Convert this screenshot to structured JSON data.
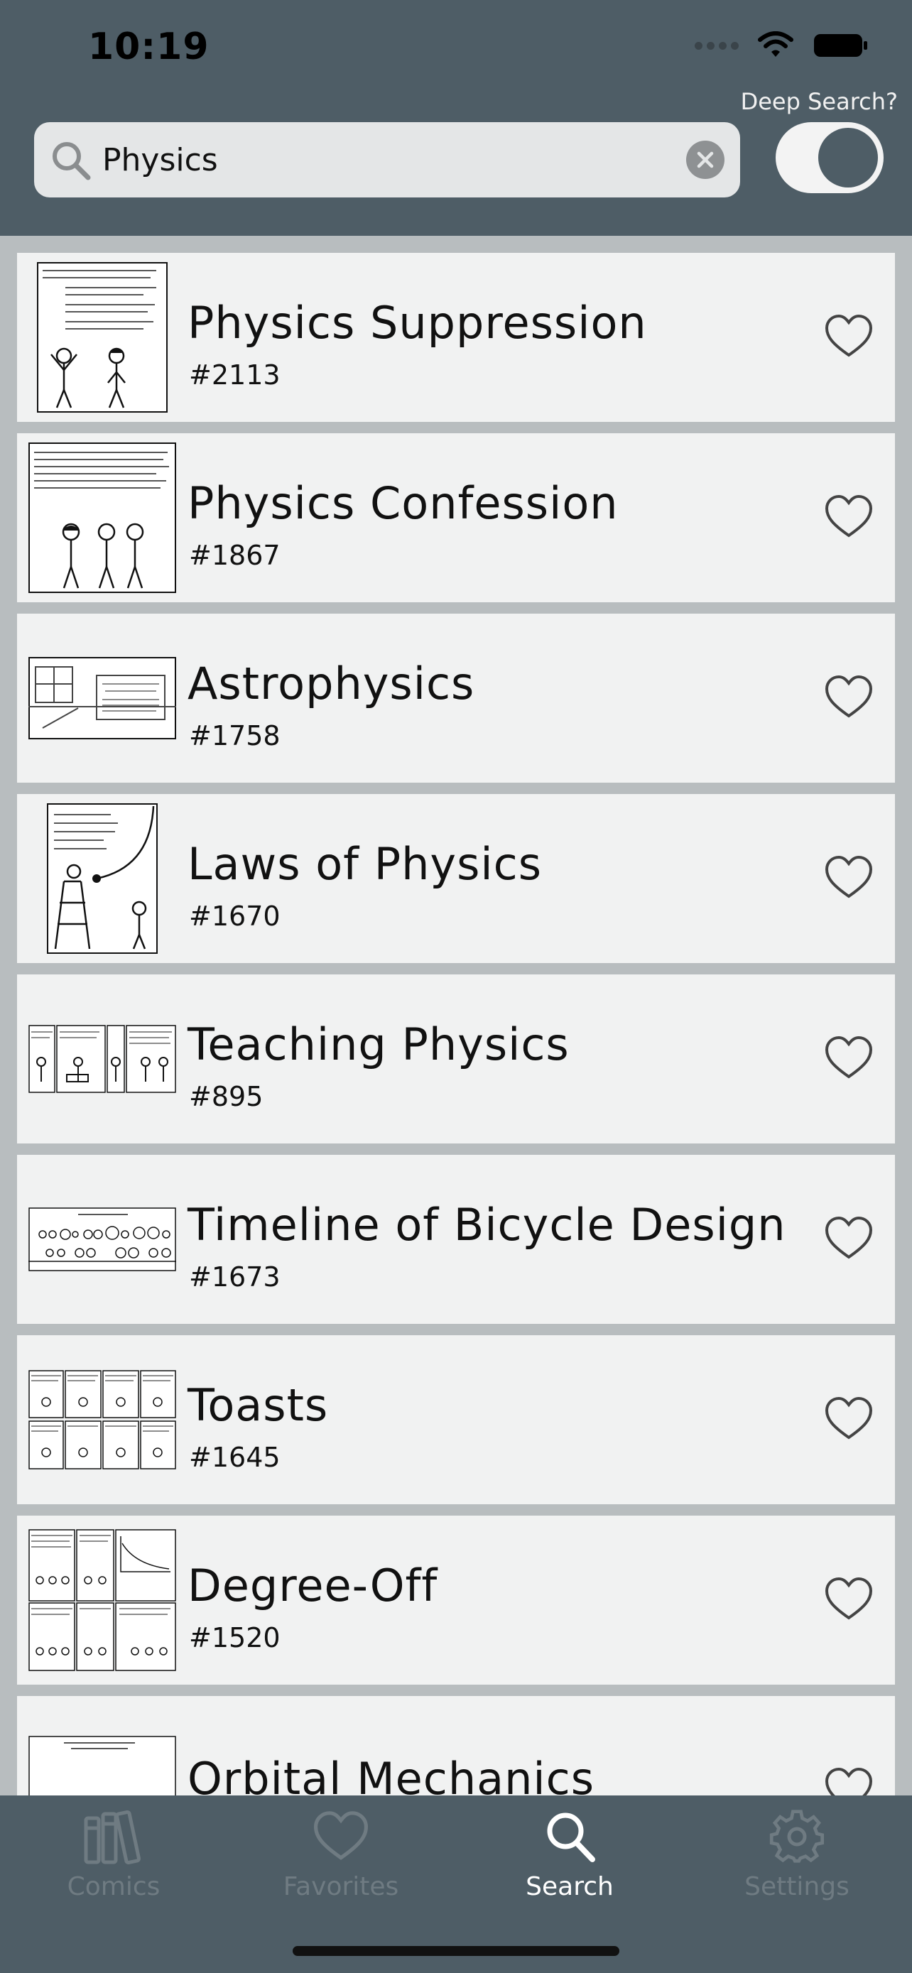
{
  "status_bar": {
    "time": "10:19"
  },
  "header": {
    "deep_search_label": "Deep Search?",
    "deep_search_on": true,
    "search": {
      "value": "Physics",
      "placeholder": "Search"
    }
  },
  "results": [
    {
      "title": "Physics Suppression",
      "number": "#2113",
      "favorite": false
    },
    {
      "title": "Physics Confession",
      "number": "#1867",
      "favorite": false
    },
    {
      "title": "Astrophysics",
      "number": "#1758",
      "favorite": false
    },
    {
      "title": "Laws of Physics",
      "number": "#1670",
      "favorite": false
    },
    {
      "title": "Teaching Physics",
      "number": "#895",
      "favorite": false
    },
    {
      "title": "Timeline of Bicycle Design",
      "number": "#1673",
      "favorite": false
    },
    {
      "title": "Toasts",
      "number": "#1645",
      "favorite": false
    },
    {
      "title": "Degree-Off",
      "number": "#1520",
      "favorite": false
    },
    {
      "title": "Orbital Mechanics",
      "number": "",
      "favorite": false
    }
  ],
  "tabs": [
    {
      "label": "Comics",
      "icon": "books-icon",
      "active": false
    },
    {
      "label": "Favorites",
      "icon": "heart-icon",
      "active": false
    },
    {
      "label": "Search",
      "icon": "search-icon",
      "active": true
    },
    {
      "label": "Settings",
      "icon": "gear-icon",
      "active": false
    }
  ],
  "colors": {
    "header": "#4e5d66",
    "row_background": "#f1f2f2",
    "list_background": "#b8bdbf",
    "tab_active": "#ffffff",
    "tab_inactive": "#6f7b82"
  }
}
